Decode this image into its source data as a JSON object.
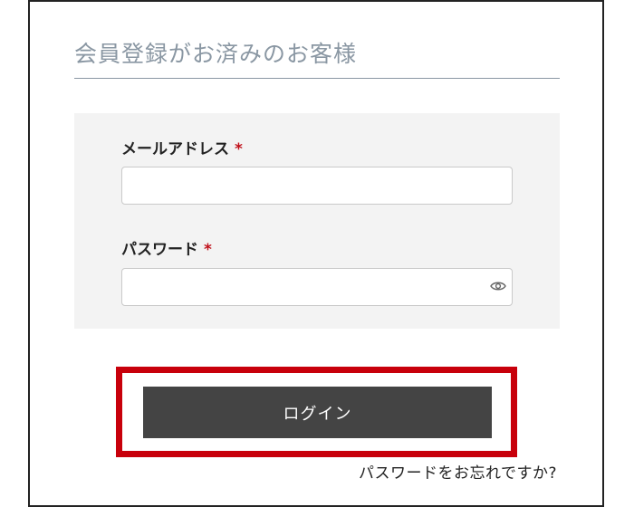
{
  "section": {
    "title": "会員登録がお済みのお客様"
  },
  "form": {
    "email": {
      "label": "メールアドレス",
      "required_mark": "*",
      "value": "",
      "placeholder": ""
    },
    "password": {
      "label": "パスワード",
      "required_mark": "*",
      "value": "",
      "placeholder": "",
      "toggle_icon": "eye-icon"
    }
  },
  "actions": {
    "login_label": "ログイン",
    "forgot_password_label": "パスワードをお忘れですか?"
  },
  "colors": {
    "title": "#8a97a3",
    "panel_bg": "#f3f3f3",
    "required": "#c0101a",
    "button_bg": "#444444",
    "highlight": "#c8000b"
  }
}
